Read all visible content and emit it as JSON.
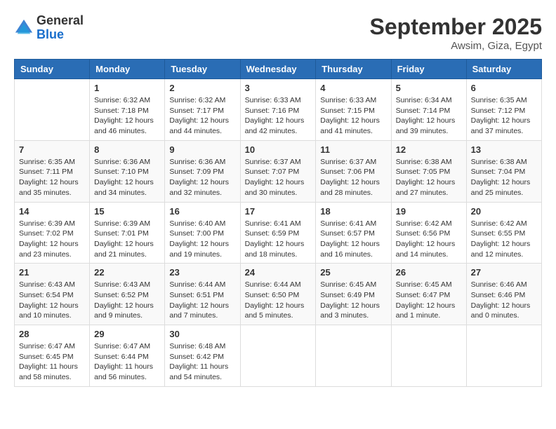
{
  "header": {
    "logo_general": "General",
    "logo_blue": "Blue",
    "month_title": "September 2025",
    "location": "Awsim, Giza, Egypt"
  },
  "weekdays": [
    "Sunday",
    "Monday",
    "Tuesday",
    "Wednesday",
    "Thursday",
    "Friday",
    "Saturday"
  ],
  "weeks": [
    [
      {
        "day": "",
        "info": ""
      },
      {
        "day": "1",
        "info": "Sunrise: 6:32 AM\nSunset: 7:18 PM\nDaylight: 12 hours\nand 46 minutes."
      },
      {
        "day": "2",
        "info": "Sunrise: 6:32 AM\nSunset: 7:17 PM\nDaylight: 12 hours\nand 44 minutes."
      },
      {
        "day": "3",
        "info": "Sunrise: 6:33 AM\nSunset: 7:16 PM\nDaylight: 12 hours\nand 42 minutes."
      },
      {
        "day": "4",
        "info": "Sunrise: 6:33 AM\nSunset: 7:15 PM\nDaylight: 12 hours\nand 41 minutes."
      },
      {
        "day": "5",
        "info": "Sunrise: 6:34 AM\nSunset: 7:14 PM\nDaylight: 12 hours\nand 39 minutes."
      },
      {
        "day": "6",
        "info": "Sunrise: 6:35 AM\nSunset: 7:12 PM\nDaylight: 12 hours\nand 37 minutes."
      }
    ],
    [
      {
        "day": "7",
        "info": "Sunrise: 6:35 AM\nSunset: 7:11 PM\nDaylight: 12 hours\nand 35 minutes."
      },
      {
        "day": "8",
        "info": "Sunrise: 6:36 AM\nSunset: 7:10 PM\nDaylight: 12 hours\nand 34 minutes."
      },
      {
        "day": "9",
        "info": "Sunrise: 6:36 AM\nSunset: 7:09 PM\nDaylight: 12 hours\nand 32 minutes."
      },
      {
        "day": "10",
        "info": "Sunrise: 6:37 AM\nSunset: 7:07 PM\nDaylight: 12 hours\nand 30 minutes."
      },
      {
        "day": "11",
        "info": "Sunrise: 6:37 AM\nSunset: 7:06 PM\nDaylight: 12 hours\nand 28 minutes."
      },
      {
        "day": "12",
        "info": "Sunrise: 6:38 AM\nSunset: 7:05 PM\nDaylight: 12 hours\nand 27 minutes."
      },
      {
        "day": "13",
        "info": "Sunrise: 6:38 AM\nSunset: 7:04 PM\nDaylight: 12 hours\nand 25 minutes."
      }
    ],
    [
      {
        "day": "14",
        "info": "Sunrise: 6:39 AM\nSunset: 7:02 PM\nDaylight: 12 hours\nand 23 minutes."
      },
      {
        "day": "15",
        "info": "Sunrise: 6:39 AM\nSunset: 7:01 PM\nDaylight: 12 hours\nand 21 minutes."
      },
      {
        "day": "16",
        "info": "Sunrise: 6:40 AM\nSunset: 7:00 PM\nDaylight: 12 hours\nand 19 minutes."
      },
      {
        "day": "17",
        "info": "Sunrise: 6:41 AM\nSunset: 6:59 PM\nDaylight: 12 hours\nand 18 minutes."
      },
      {
        "day": "18",
        "info": "Sunrise: 6:41 AM\nSunset: 6:57 PM\nDaylight: 12 hours\nand 16 minutes."
      },
      {
        "day": "19",
        "info": "Sunrise: 6:42 AM\nSunset: 6:56 PM\nDaylight: 12 hours\nand 14 minutes."
      },
      {
        "day": "20",
        "info": "Sunrise: 6:42 AM\nSunset: 6:55 PM\nDaylight: 12 hours\nand 12 minutes."
      }
    ],
    [
      {
        "day": "21",
        "info": "Sunrise: 6:43 AM\nSunset: 6:54 PM\nDaylight: 12 hours\nand 10 minutes."
      },
      {
        "day": "22",
        "info": "Sunrise: 6:43 AM\nSunset: 6:52 PM\nDaylight: 12 hours\nand 9 minutes."
      },
      {
        "day": "23",
        "info": "Sunrise: 6:44 AM\nSunset: 6:51 PM\nDaylight: 12 hours\nand 7 minutes."
      },
      {
        "day": "24",
        "info": "Sunrise: 6:44 AM\nSunset: 6:50 PM\nDaylight: 12 hours\nand 5 minutes."
      },
      {
        "day": "25",
        "info": "Sunrise: 6:45 AM\nSunset: 6:49 PM\nDaylight: 12 hours\nand 3 minutes."
      },
      {
        "day": "26",
        "info": "Sunrise: 6:45 AM\nSunset: 6:47 PM\nDaylight: 12 hours\nand 1 minute."
      },
      {
        "day": "27",
        "info": "Sunrise: 6:46 AM\nSunset: 6:46 PM\nDaylight: 12 hours\nand 0 minutes."
      }
    ],
    [
      {
        "day": "28",
        "info": "Sunrise: 6:47 AM\nSunset: 6:45 PM\nDaylight: 11 hours\nand 58 minutes."
      },
      {
        "day": "29",
        "info": "Sunrise: 6:47 AM\nSunset: 6:44 PM\nDaylight: 11 hours\nand 56 minutes."
      },
      {
        "day": "30",
        "info": "Sunrise: 6:48 AM\nSunset: 6:42 PM\nDaylight: 11 hours\nand 54 minutes."
      },
      {
        "day": "",
        "info": ""
      },
      {
        "day": "",
        "info": ""
      },
      {
        "day": "",
        "info": ""
      },
      {
        "day": "",
        "info": ""
      }
    ]
  ]
}
